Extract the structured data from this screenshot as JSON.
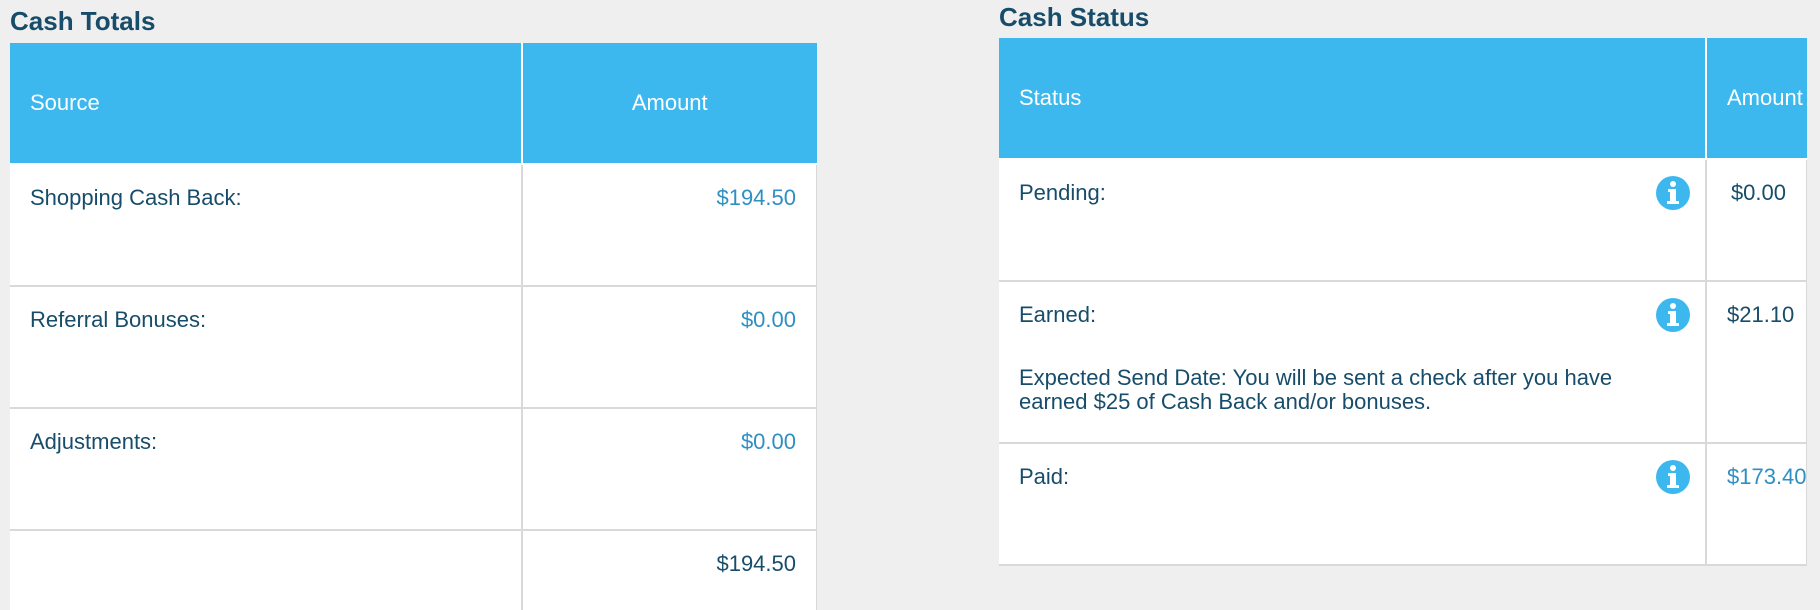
{
  "cash_totals": {
    "title": "Cash Totals",
    "headers": {
      "source": "Source",
      "amount": "Amount"
    },
    "rows": [
      {
        "source": "Shopping Cash Back:",
        "amount": "$194.50"
      },
      {
        "source": "Referral Bonuses:",
        "amount": "$0.00"
      },
      {
        "source": "Adjustments:",
        "amount": "$0.00"
      }
    ],
    "total": {
      "source": "",
      "amount": "$194.50"
    }
  },
  "cash_status": {
    "title": "Cash Status",
    "headers": {
      "status": "Status",
      "amount": "Amount"
    },
    "rows": [
      {
        "status": "Pending:",
        "amount": "$0.00",
        "icon": "info-icon"
      },
      {
        "status": "Earned:",
        "amount": "$21.10",
        "icon": "info-icon",
        "note": "Expected Send Date: You will be sent a check after you have earned $25 of Cash Back and/or bonuses."
      },
      {
        "status": "Paid:",
        "amount": "$173.40",
        "icon": "info-icon"
      }
    ]
  },
  "colors": {
    "header_bg": "#3db8ee",
    "title_text": "#174d6a",
    "link_amount": "#2e8fc4",
    "page_bg": "#efefef"
  }
}
